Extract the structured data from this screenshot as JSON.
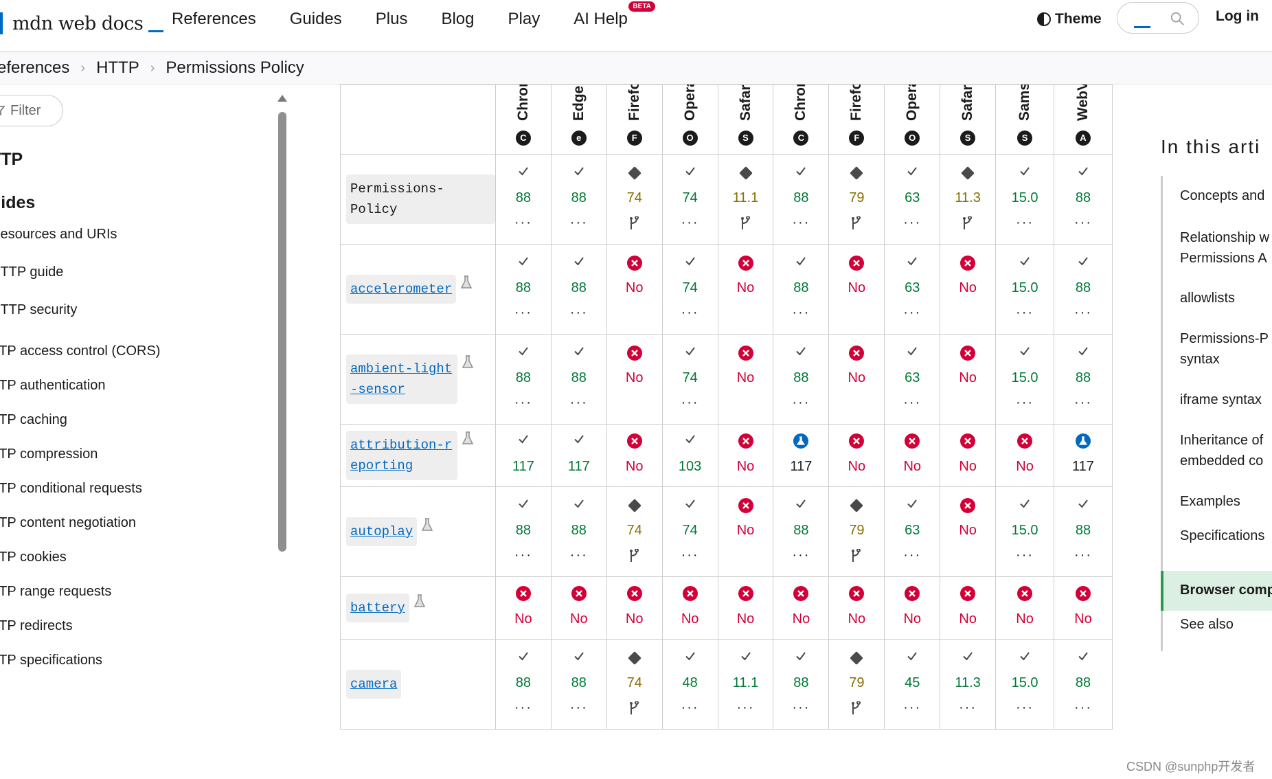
{
  "header": {
    "logo_text": "mdn web docs",
    "nav": [
      "References",
      "Guides",
      "Plus",
      "Blog",
      "Play",
      "AI Help"
    ],
    "beta_badge": "BETA",
    "theme_label": "Theme",
    "login_label": "Log in"
  },
  "breadcrumb": [
    "eferences",
    "HTTP",
    "Permissions Policy"
  ],
  "sidebar": {
    "filter_placeholder": "Filter",
    "items": [
      {
        "label": "TTP",
        "kind": "head"
      },
      {
        "label": "uides",
        "kind": "head"
      },
      {
        "label": "Resources and URIs",
        "kind": "link"
      },
      {
        "label": "HTTP guide",
        "kind": "link"
      },
      {
        "label": "HTTP security",
        "kind": "link"
      },
      {
        "label": "TTP access control (CORS)",
        "kind": "link"
      },
      {
        "label": "TTP authentication",
        "kind": "link"
      },
      {
        "label": "TTP caching",
        "kind": "link"
      },
      {
        "label": "TTP compression",
        "kind": "link"
      },
      {
        "label": "TTP conditional requests",
        "kind": "link"
      },
      {
        "label": "TTP content negotiation",
        "kind": "link"
      },
      {
        "label": "TTP cookies",
        "kind": "link"
      },
      {
        "label": "TTP range requests",
        "kind": "link"
      },
      {
        "label": "TTP redirects",
        "kind": "link"
      },
      {
        "label": "TTP specifications",
        "kind": "link"
      }
    ]
  },
  "table": {
    "browsers": [
      {
        "name": "Chrome",
        "icon": "chrome-icon",
        "glyph": "C"
      },
      {
        "name": "Edge",
        "icon": "edge-icon",
        "glyph": "e"
      },
      {
        "name": "Firefox",
        "icon": "firefox-icon",
        "glyph": "F"
      },
      {
        "name": "Opera",
        "icon": "opera-icon",
        "glyph": "O"
      },
      {
        "name": "Safari",
        "icon": "safari-icon",
        "glyph": "S"
      },
      {
        "name": "Chrome",
        "icon": "chrome-android-icon",
        "glyph": "C"
      },
      {
        "name": "Firefox",
        "icon": "firefox-android-icon",
        "glyph": "F"
      },
      {
        "name": "Opera",
        "icon": "opera-android-icon",
        "glyph": "O"
      },
      {
        "name": "Safari",
        "icon": "safari-ios-icon",
        "glyph": "S"
      },
      {
        "name": "Samsung",
        "icon": "samsung-icon",
        "glyph": "S"
      },
      {
        "name": "WebView",
        "icon": "android-icon",
        "glyph": "A"
      }
    ],
    "rows": [
      {
        "feature": "Permissions-Policy",
        "link": false,
        "experimental": false,
        "height": "tall",
        "cells": [
          {
            "s": "yes",
            "v": "88",
            "more": "dots"
          },
          {
            "s": "yes",
            "v": "88",
            "more": "dots"
          },
          {
            "s": "partial",
            "v": "74",
            "more": "flag"
          },
          {
            "s": "yes",
            "v": "74",
            "more": "dots"
          },
          {
            "s": "partial",
            "v": "11.1",
            "more": "flag"
          },
          {
            "s": "yes",
            "v": "88",
            "more": "dots"
          },
          {
            "s": "partial",
            "v": "79",
            "more": "flag"
          },
          {
            "s": "yes",
            "v": "63",
            "more": "dots"
          },
          {
            "s": "partial",
            "v": "11.3",
            "more": "flag"
          },
          {
            "s": "yes",
            "v": "15.0",
            "more": "dots"
          },
          {
            "s": "yes",
            "v": "88",
            "more": "dots"
          }
        ]
      },
      {
        "feature": "accelerometer",
        "link": true,
        "experimental": true,
        "height": "tall",
        "cells": [
          {
            "s": "yes",
            "v": "88",
            "more": "dots"
          },
          {
            "s": "yes",
            "v": "88",
            "more": "dots"
          },
          {
            "s": "no",
            "v": "No",
            "more": ""
          },
          {
            "s": "yes",
            "v": "74",
            "more": "dots"
          },
          {
            "s": "no",
            "v": "No",
            "more": ""
          },
          {
            "s": "yes",
            "v": "88",
            "more": "dots"
          },
          {
            "s": "no",
            "v": "No",
            "more": ""
          },
          {
            "s": "yes",
            "v": "63",
            "more": "dots"
          },
          {
            "s": "no",
            "v": "No",
            "more": ""
          },
          {
            "s": "yes",
            "v": "15.0",
            "more": "dots"
          },
          {
            "s": "yes",
            "v": "88",
            "more": "dots"
          }
        ]
      },
      {
        "feature": "ambient-light-sensor",
        "link": true,
        "experimental": true,
        "height": "tall",
        "cells": [
          {
            "s": "yes",
            "v": "88",
            "more": "dots"
          },
          {
            "s": "yes",
            "v": "88",
            "more": "dots"
          },
          {
            "s": "no",
            "v": "No",
            "more": ""
          },
          {
            "s": "yes",
            "v": "74",
            "more": "dots"
          },
          {
            "s": "no",
            "v": "No",
            "more": ""
          },
          {
            "s": "yes",
            "v": "88",
            "more": "dots"
          },
          {
            "s": "no",
            "v": "No",
            "more": ""
          },
          {
            "s": "yes",
            "v": "63",
            "more": "dots"
          },
          {
            "s": "no",
            "v": "No",
            "more": ""
          },
          {
            "s": "yes",
            "v": "15.0",
            "more": "dots"
          },
          {
            "s": "yes",
            "v": "88",
            "more": "dots"
          }
        ]
      },
      {
        "feature": "attribution-reporting",
        "link": true,
        "experimental": true,
        "height": "short",
        "cells": [
          {
            "s": "yes",
            "v": "117",
            "more": ""
          },
          {
            "s": "yes",
            "v": "117",
            "more": ""
          },
          {
            "s": "no",
            "v": "No",
            "more": ""
          },
          {
            "s": "yes",
            "v": "103",
            "more": ""
          },
          {
            "s": "no",
            "v": "No",
            "more": ""
          },
          {
            "s": "preview",
            "v": "117",
            "more": ""
          },
          {
            "s": "no",
            "v": "No",
            "more": ""
          },
          {
            "s": "no",
            "v": "No",
            "more": ""
          },
          {
            "s": "no",
            "v": "No",
            "more": ""
          },
          {
            "s": "no",
            "v": "No",
            "more": ""
          },
          {
            "s": "preview",
            "v": "117",
            "more": ""
          }
        ]
      },
      {
        "feature": "autoplay",
        "link": true,
        "experimental": true,
        "height": "tall",
        "cells": [
          {
            "s": "yes",
            "v": "88",
            "more": "dots"
          },
          {
            "s": "yes",
            "v": "88",
            "more": "dots"
          },
          {
            "s": "partial",
            "v": "74",
            "more": "flag"
          },
          {
            "s": "yes",
            "v": "74",
            "more": "dots"
          },
          {
            "s": "no",
            "v": "No",
            "more": ""
          },
          {
            "s": "yes",
            "v": "88",
            "more": "dots"
          },
          {
            "s": "partial",
            "v": "79",
            "more": "flag"
          },
          {
            "s": "yes",
            "v": "63",
            "more": "dots"
          },
          {
            "s": "no",
            "v": "No",
            "more": ""
          },
          {
            "s": "yes",
            "v": "15.0",
            "more": "dots"
          },
          {
            "s": "yes",
            "v": "88",
            "more": "dots"
          }
        ]
      },
      {
        "feature": "battery",
        "link": true,
        "experimental": true,
        "height": "short",
        "cells": [
          {
            "s": "no",
            "v": "No",
            "more": ""
          },
          {
            "s": "no",
            "v": "No",
            "more": ""
          },
          {
            "s": "no",
            "v": "No",
            "more": ""
          },
          {
            "s": "no",
            "v": "No",
            "more": ""
          },
          {
            "s": "no",
            "v": "No",
            "more": ""
          },
          {
            "s": "no",
            "v": "No",
            "more": ""
          },
          {
            "s": "no",
            "v": "No",
            "more": ""
          },
          {
            "s": "no",
            "v": "No",
            "more": ""
          },
          {
            "s": "no",
            "v": "No",
            "more": ""
          },
          {
            "s": "no",
            "v": "No",
            "more": ""
          },
          {
            "s": "no",
            "v": "No",
            "more": ""
          }
        ]
      },
      {
        "feature": "camera",
        "link": true,
        "experimental": false,
        "height": "tall",
        "cells": [
          {
            "s": "yes",
            "v": "88",
            "more": "dots"
          },
          {
            "s": "yes",
            "v": "88",
            "more": "dots"
          },
          {
            "s": "partial",
            "v": "74",
            "more": "flag"
          },
          {
            "s": "yes",
            "v": "48",
            "more": "dots"
          },
          {
            "s": "yes",
            "v": "11.1",
            "more": "dots"
          },
          {
            "s": "yes",
            "v": "88",
            "more": "dots"
          },
          {
            "s": "partial",
            "v": "79",
            "more": "flag"
          },
          {
            "s": "yes",
            "v": "45",
            "more": "dots"
          },
          {
            "s": "yes",
            "v": "11.3",
            "more": "dots"
          },
          {
            "s": "yes",
            "v": "15.0",
            "more": "dots"
          },
          {
            "s": "yes",
            "v": "88",
            "more": "dots"
          }
        ]
      }
    ],
    "colors": {
      "yes": "#007936",
      "partial": "#8a6d00",
      "no": "#d30038",
      "preview": "#1b1b1b",
      "info": "#0069c2"
    }
  },
  "toc": {
    "title": "In this arti",
    "items": [
      "Concepts and",
      "Relationship w",
      "Permissions A",
      "allowlists",
      "Permissions-P",
      "syntax",
      "iframe syntax",
      "Inheritance of",
      "embedded co",
      "Examples",
      "Specifications",
      "Browser comp",
      "See also"
    ],
    "active_item": "Browser comp"
  },
  "watermark": "CSDN @sunphp开发者"
}
